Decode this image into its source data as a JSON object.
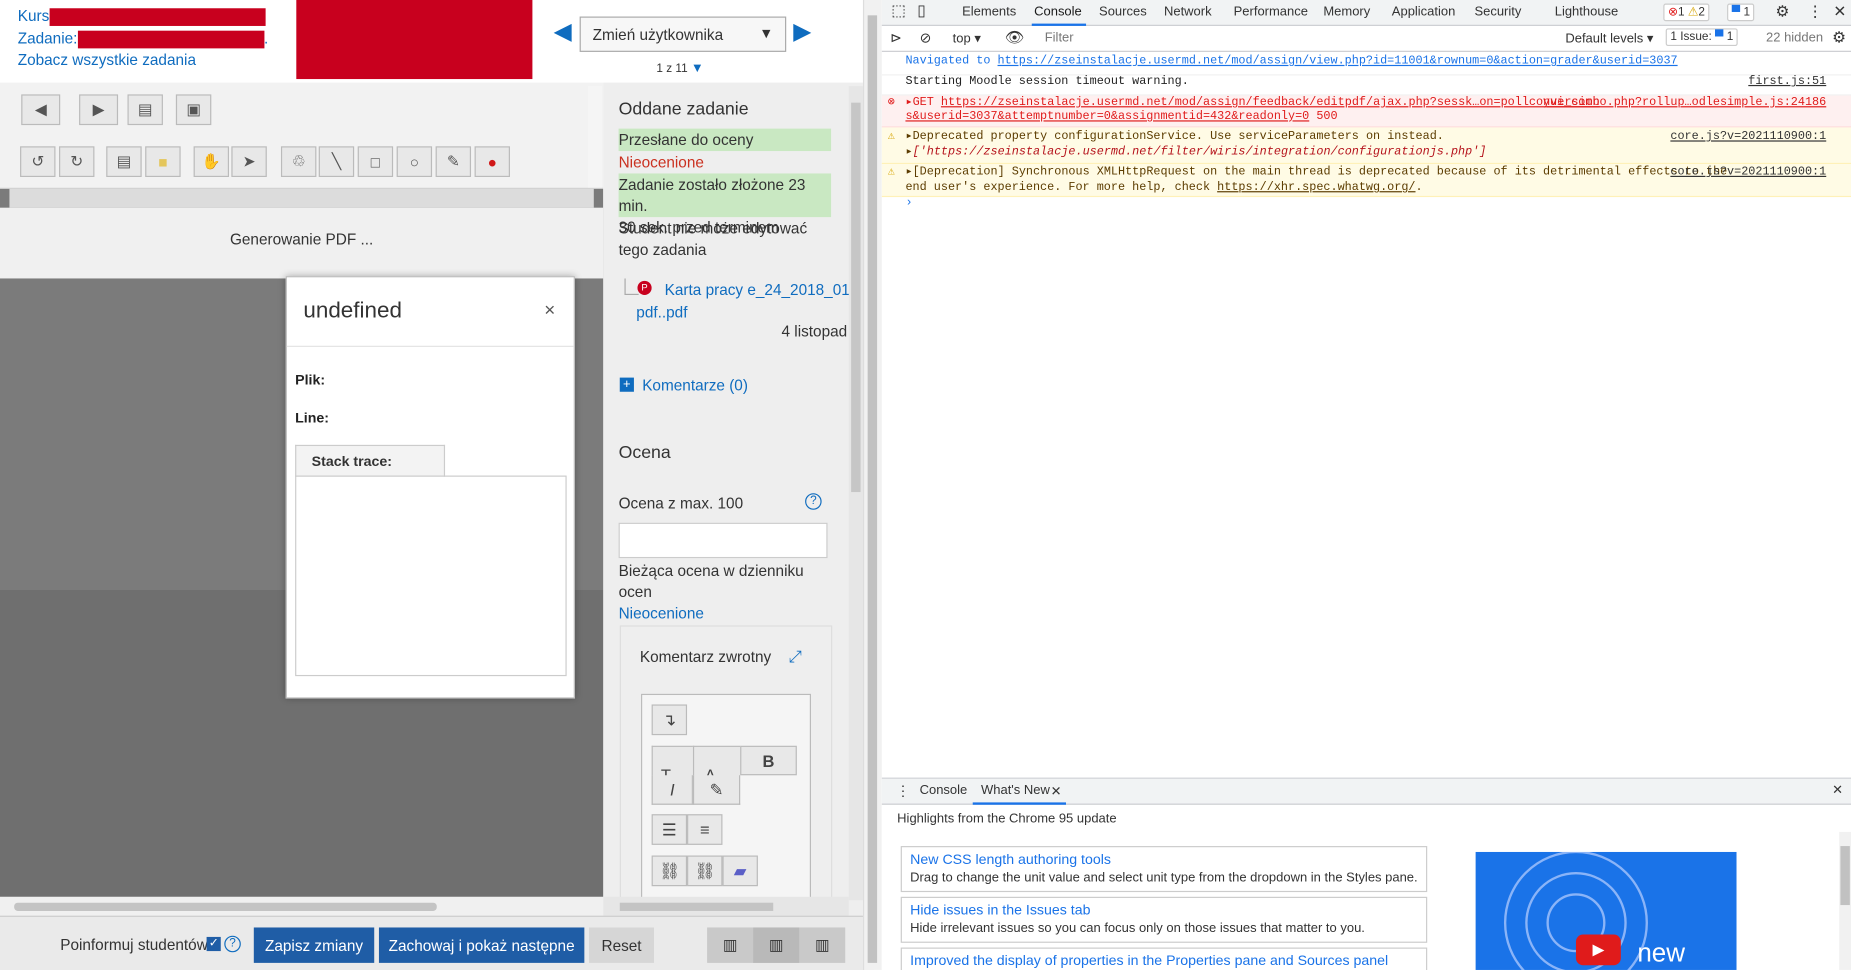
{
  "moodle": {
    "course_label": "Kurs",
    "assignment_label": "Zadanie:",
    "view_all": "Zobacz wszystkie zadania",
    "user_select": "Zmień użytkownika",
    "pager": "1 z 11",
    "generating_pdf": "Generowanie PDF ...",
    "panel": {
      "submitted_heading": "Oddane zadanie",
      "status_submitted": "Przesłane do oceny",
      "status_not_graded": "Nieocenione",
      "submitted_early_1": "Zadanie zostało złożone 23 min.",
      "submitted_early_2": "30 sek. przed terminem",
      "cannot_edit_1": "Student nie może edytować",
      "cannot_edit_2": "tego zadania",
      "file_name_1": "Karta pracy e_24_2018_01_",
      "file_name_2": "pdf..pdf",
      "file_date": "4 listopad",
      "comments": "Komentarze (0)",
      "grade_heading": "Ocena",
      "grade_out_of": "Ocena z max. 100",
      "current_grade_1": "Bieżąca ocena w dzienniku",
      "current_grade_2": "ocen",
      "current_grade_value": "Nieocenione",
      "feedback_label": "Komentarz zwrotny"
    },
    "bottom": {
      "notify_label": "Poinformuj studentów",
      "save": "Zapisz zmiany",
      "save_next": "Zachowaj i pokaż następne",
      "reset": "Reset"
    },
    "dialog": {
      "title": "undefined",
      "close": "×",
      "file_label": "Plik:",
      "line_label": "Line:",
      "stack_tab": "Stack trace:"
    }
  },
  "devtools": {
    "tabs": [
      "Elements",
      "Console",
      "Sources",
      "Network",
      "Performance",
      "Memory",
      "Application",
      "Security",
      "Lighthouse"
    ],
    "active_tab": "Console",
    "errors": "1",
    "warnings": "2",
    "messages": "1",
    "context": "top",
    "filter_placeholder": "Filter",
    "levels": "Default levels",
    "issues": "1 Issue:",
    "issues_count": "1",
    "hidden": "22 hidden",
    "log": {
      "nav_prefix": "Navigated to ",
      "nav_url": "https://zseinstalacje.usermd.net/mod/assign/view.php?id=11001&rownum=0&action=grader&userid=3037",
      "timeout": "Starting Moodle session timeout warning.",
      "timeout_src": "first.js:51",
      "err_method": "GET",
      "err_url_1": "https://zseinstalacje.usermd.net/mod/assign/feedback/editpdf/ajax.php?sessk…on=pollconversion",
      "err_url_2": "s&userid=3037&attemptnumber=0&assignmentid=432&readonly=0",
      "err_code": "500",
      "err_src": "yui_combo.php?rollup…odlesimple.js:24186",
      "warn1": "Deprecated property configurationService. Use serviceParameters on instead.",
      "warn1_src": "core.js?v=2021110900:1",
      "warn1_arr": "['https://zseinstalacje.usermd.net/filter/wiris/integration/configurationjs.php']",
      "warn2_a": "[Deprecation] Synchronous XMLHttpRequest on the main thread is deprecated because of its detrimental effects to the",
      "warn2_b": "end user's experience. For more help, check ",
      "warn2_link": "https://xhr.spec.whatwg.org/",
      "warn2_src": "core.js?v=2021110900:1",
      "prompt": "›"
    },
    "drawer": {
      "tab_console": "Console",
      "tab_whatsnew": "What's New",
      "highlights": "Highlights from the Chrome 95 update",
      "items": [
        {
          "title": "New CSS length authoring tools",
          "desc": "Drag to change the unit value and select unit type from the dropdown in the Styles pane."
        },
        {
          "title": "Hide issues in the Issues tab",
          "desc": "Hide irrelevant issues so you can focus only on those issues that matter to you."
        },
        {
          "title": "Improved the display of properties in the Properties pane and Sources panel",
          "desc": ""
        }
      ],
      "video_text": "new"
    }
  },
  "colors": {
    "accent": "#0f6cbf",
    "redact": "#c8001e",
    "button_primary": "#1f5da6",
    "devtools_blue": "#1a73e8"
  }
}
